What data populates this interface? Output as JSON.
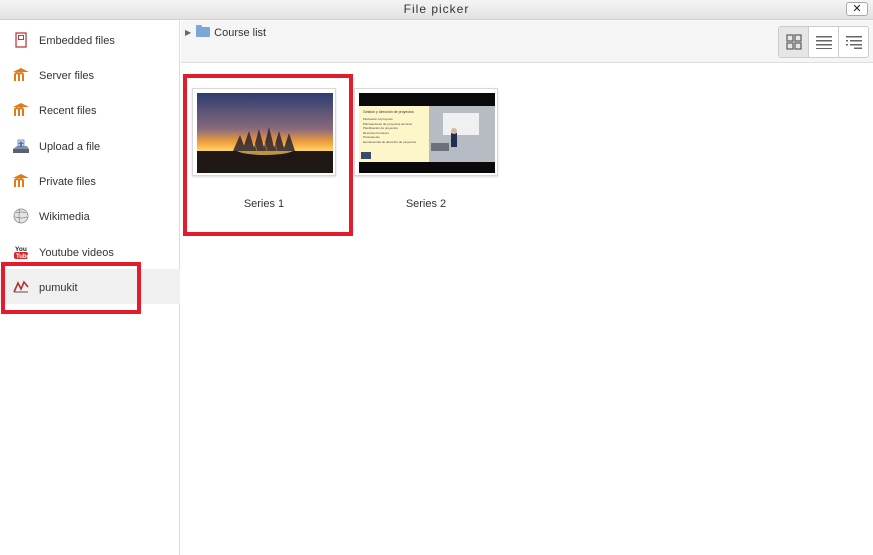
{
  "window": {
    "title": "File picker",
    "close_label": "✕"
  },
  "sidebar": {
    "items": [
      {
        "label": "Embedded files",
        "icon": "embedded-files-icon"
      },
      {
        "label": "Server files",
        "icon": "moodle-icon"
      },
      {
        "label": "Recent files",
        "icon": "moodle-icon"
      },
      {
        "label": "Upload a file",
        "icon": "upload-icon"
      },
      {
        "label": "Private files",
        "icon": "moodle-icon"
      },
      {
        "label": "Wikimedia",
        "icon": "wikimedia-icon"
      },
      {
        "label": "Youtube videos",
        "icon": "youtube-icon"
      },
      {
        "label": "pumukit",
        "icon": "pumukit-icon",
        "active": true
      }
    ]
  },
  "breadcrumb": {
    "label": "Course list"
  },
  "view_buttons": [
    "icons-view",
    "list-view",
    "tree-view"
  ],
  "files": [
    {
      "label": "Series 1",
      "thumbnail": "sunset-boats"
    },
    {
      "label": "Series 2",
      "thumbnail": "lecture-slides"
    }
  ],
  "slide": {
    "heading": "Gestión y dirección de proyectos",
    "bullets": [
      "Motivación al proyecto",
      "Planteamiento de proyectos técnicos",
      "Planificación de proyectos",
      "Recursos humanos",
      "Presupuesto",
      "Herramientas de dirección de proyectos"
    ]
  },
  "colors": {
    "highlight": "#e11d2b",
    "folder": "#7ba7d6"
  }
}
